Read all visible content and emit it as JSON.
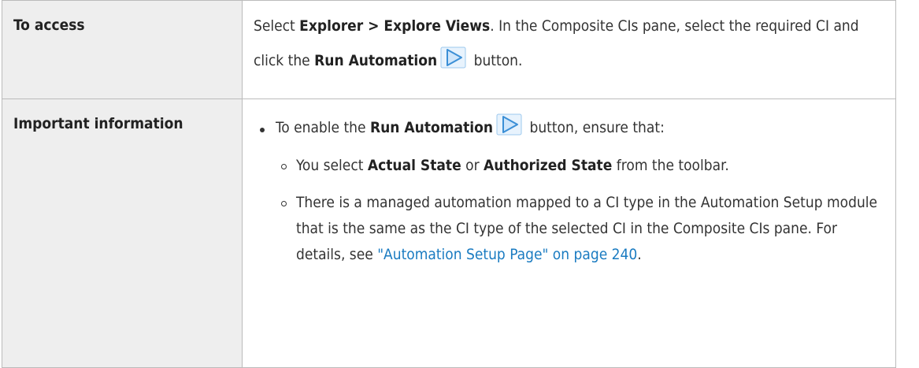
{
  "rows": {
    "access": {
      "label": "To access",
      "t1": "Select ",
      "b1": "Explorer > Explore Views",
      "t2": ". In the Composite CIs pane, select the required CI and click the ",
      "b2": "Run Automation",
      "t3": " button."
    },
    "info": {
      "label": "Important information",
      "bullet": {
        "t1": "To enable the ",
        "b1": "Run Automation",
        "t2": " button, ensure that:"
      },
      "sub1": {
        "t1": "You select ",
        "b1": "Actual State",
        "t2": " or ",
        "b2": "Authorized State",
        "t3": " from the toolbar."
      },
      "sub2": {
        "t1": "There is a managed automation mapped to a CI type in the Automation Setup module that is the same as the CI type of the selected CI in the Composite CIs pane. For details, see ",
        "link": "\"Automation Setup Page\" on page 240",
        "t2": "."
      }
    }
  },
  "icons": {
    "run_automation": "play-triangle-icon"
  },
  "colors": {
    "label_bg": "#eeeeee",
    "border": "#bbbbbb",
    "link": "#1a7bc1",
    "icon_fill": "#cfe6fb",
    "icon_stroke": "#3b8fd6"
  }
}
